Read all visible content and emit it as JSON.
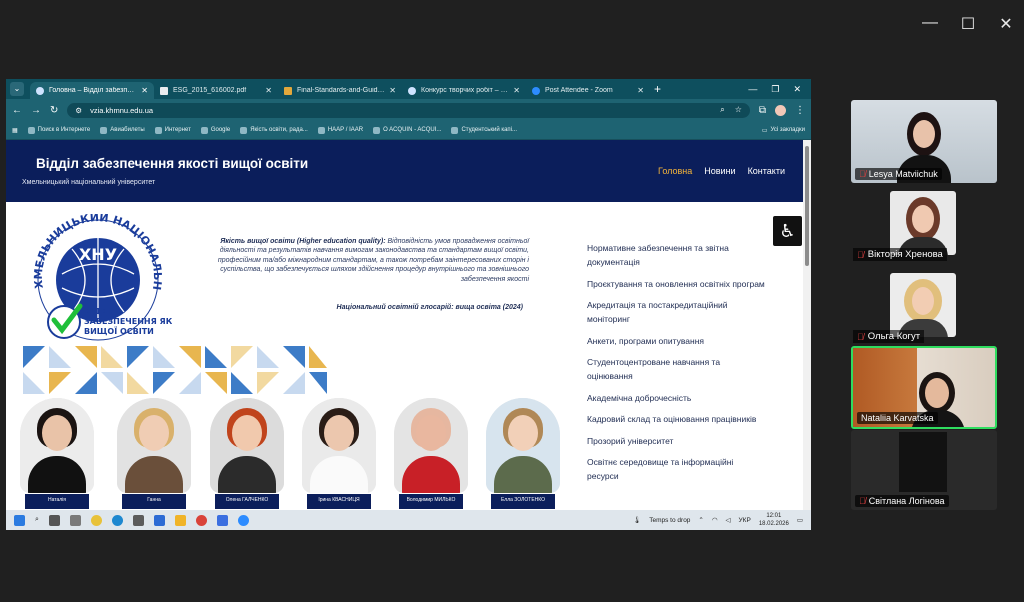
{
  "outer_window": {
    "minimize": "—",
    "maximize": "☐",
    "close": "✕"
  },
  "browser": {
    "tabs": [
      {
        "label": "Головна – Відділ забезпечення",
        "active": true
      },
      {
        "label": "ESG_2015_616002.pdf",
        "active": false
      },
      {
        "label": "Final-Standards-and-Guidelines",
        "active": false
      },
      {
        "label": "Конкурс творчих робіт – РАЗО",
        "active": false
      },
      {
        "label": "Post Attendee - Zoom",
        "active": false
      }
    ],
    "new_tab": "+",
    "url": "vzia.khmnu.edu.ua",
    "bookmarks": [
      "Поиск в Интернете",
      "Авиабилеты",
      "Интернет",
      "Google",
      "Якість освіти, рада...",
      "HAAP / IAAR",
      "O ACQUIN - ACQUI...",
      "Студентський капі..."
    ],
    "bookmarks_folder": "Усі закладки"
  },
  "site": {
    "title": "Відділ забезпечення якості вищої освіти",
    "subtitle": "Хмельницький національний університет",
    "nav": [
      "Головна",
      "Новини",
      "Контакти"
    ],
    "logo": {
      "ring_text": "ХМЕЛЬНИЦЬКИЙ НАЦІОНАЛЬНИЙ УНІВЕРСИТЕТ",
      "abbr": "ХНУ",
      "caption_1": "ВІДДІЛ",
      "caption_2": "ЗАБЕЗПЕЧЕННЯ ЯКОСТІ",
      "caption_3": "ВИЩОЇ ОСВІТИ"
    },
    "quote_term": "Якість вищої освіти (Higher education quality):",
    "quote_body": " Відповідність умов провадження освітньої діяльності та результатів навчання вимогам законодавства та стандартам вищої освіти, професійним та/або міжнародним стандартам, а також потребам заінтересованих сторін і суспільства, що забезпечується шляхом здійснення процедур внутрішнього та зовнішнього забезпечення якості",
    "quote_source": "Національний освітній глосарій: вища освіта (2024)",
    "side_links": [
      "Нормативне забезпечення та звітна документація",
      "Проєктування та оновлення освітніх програм",
      "Акредитація та постакредитаційний моніторинг",
      "Анкети, програми опитування",
      "Студентоцентроване навчання та оцінювання",
      "Академічна доброчесність",
      "Кадровий склад та оцінювання працівників",
      "Прозорий університет",
      "Освітнє середовище та інформаційні ресурси"
    ],
    "people": [
      {
        "name": "Наталія"
      },
      {
        "name": "Ганна"
      },
      {
        "name": "Олена ГАЛЧЕНКО"
      },
      {
        "name": "Ірина КВАСНИЦЯ"
      },
      {
        "name": "Володимир МИЛЬКО"
      },
      {
        "name": "Елла ЗОЛОТЕНКО"
      }
    ]
  },
  "taskbar": {
    "tray_text": "Temps to drop",
    "language": "УКР",
    "time": "12:01",
    "date": "18.02.2026"
  },
  "participants": [
    {
      "name": "Lesya Matviichuk",
      "mic": "muted"
    },
    {
      "name": "Вікторія Хренова",
      "mic": "muted"
    },
    {
      "name": "Ольга Когут",
      "mic": "muted"
    },
    {
      "name": "Nataliia Karvatska",
      "mic": "on",
      "speaking": true
    },
    {
      "name": "Світлана Логінова",
      "mic": "muted"
    }
  ],
  "colors": {
    "site_header": "#0b1e5b",
    "nav_active": "#f4b43a",
    "browser_chrome": "#1e6372",
    "active_speaker": "#2fdd5f"
  }
}
